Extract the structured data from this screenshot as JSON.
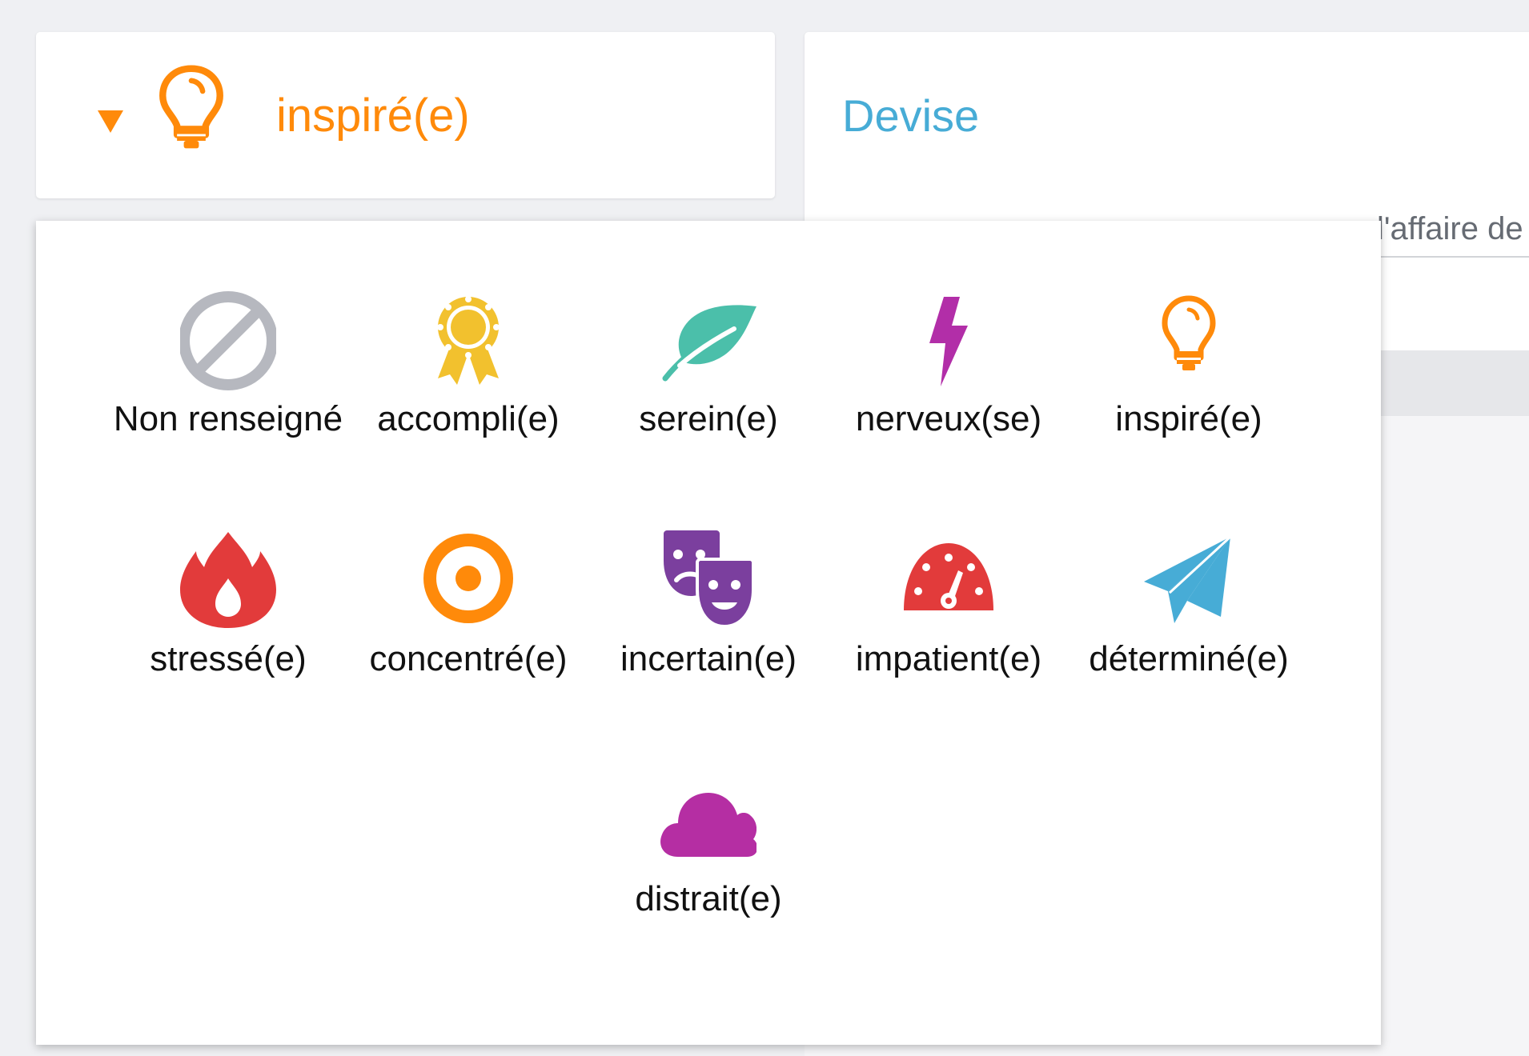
{
  "selected_mood": {
    "label": "inspiré(e)",
    "icon": "lightbulb-icon",
    "color": "#ff8a0a"
  },
  "devise": {
    "title": "Devise",
    "text_fragment": "l'affaire de",
    "title_color": "#47acd6"
  },
  "mood_options": [
    {
      "label": "Non renseigné",
      "icon": "not-set-icon",
      "color": "#b6b8bf"
    },
    {
      "label": "accompli(e)",
      "icon": "award-ribbon-icon",
      "color": "#f2c12e"
    },
    {
      "label": "serein(e)",
      "icon": "leaf-icon",
      "color": "#4bbfaa"
    },
    {
      "label": "nerveux(se)",
      "icon": "lightning-icon",
      "color": "#b22ea8"
    },
    {
      "label": "inspiré(e)",
      "icon": "lightbulb-icon",
      "color": "#ff8a0a"
    },
    {
      "label": "stressé(e)",
      "icon": "fire-icon",
      "color": "#e23b3b"
    },
    {
      "label": "concentré(e)",
      "icon": "target-icon",
      "color": "#ff8a0a"
    },
    {
      "label": "incertain(e)",
      "icon": "theater-masks-icon",
      "color": "#7b3f9e"
    },
    {
      "label": "impatient(e)",
      "icon": "speedometer-icon",
      "color": "#e23b3b"
    },
    {
      "label": "déterminé(e)",
      "icon": "paper-plane-icon",
      "color": "#47acd6"
    },
    {
      "label": "distrait(e)",
      "icon": "cloud-icon",
      "color": "#b52ea3"
    }
  ]
}
